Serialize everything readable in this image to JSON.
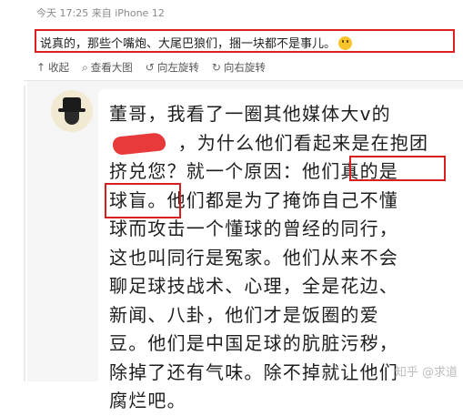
{
  "meta": {
    "line": "今天 17:25 来自 iPhone 12"
  },
  "post": {
    "text": "说真的，那些个嘴炮、大尾巴狼们，捆一块都不是事儿。"
  },
  "toolbar": {
    "collapse": "收起",
    "view_large": "查看大图",
    "rotate_left": "向左旋转",
    "rotate_right": "向右旋转"
  },
  "message": {
    "text": "董哥，我看了一圈其他媒体大v的\n          ，为什么他们看起来是在抱团\n挤兑您？就一个原因：他们真的是\n球盲。他们都是为了掩饰自己不懂\n球而攻击一个懂球的曾经的同行，\n这也叫同行是冤家。他们从来不会\n聊足球技战术、心理，全是花边、\n新闻、八卦，他们才是饭圈的爱\n豆。他们是中国足球的肮脏污秽，\n除掉了还有气味。除不掉就让他们\n腐烂吧。"
  },
  "watermark": "知乎 @求道",
  "colors": {
    "highlight_box": "#d81e1e",
    "redaction": "#e83a3a"
  }
}
